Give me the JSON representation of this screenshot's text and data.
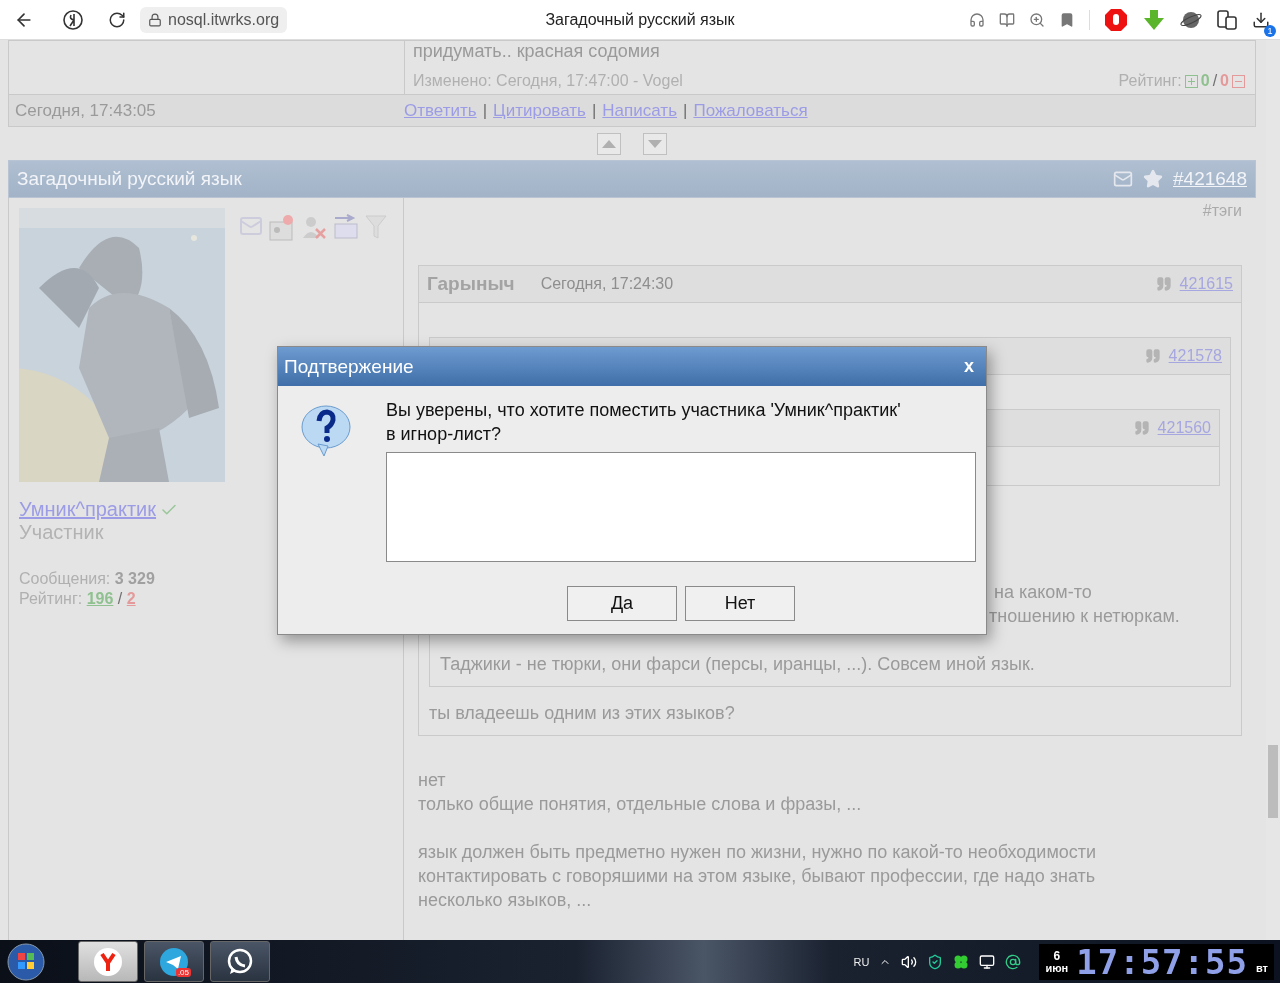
{
  "browser": {
    "url": "nosql.itwrks.org",
    "title": "Загадочный русский язык",
    "downloads_badge": "1"
  },
  "prev_post": {
    "text": "придумать.. красная содомия",
    "edited": "Изменено: Сегодня, 17:47:00 - Vogel",
    "rating_label": "Рейтинг:",
    "rating_plus": "0",
    "rating_sep": "/",
    "rating_minus": "0",
    "date": "Сегодня, 17:43:05",
    "actions": [
      "Ответить",
      "Цитировать",
      "Написать",
      "Пожаловаться"
    ],
    "action_sep": "|"
  },
  "post": {
    "title": "Загадочный русский язык",
    "number": "#421648",
    "author": {
      "name": "Умник^практик",
      "verified": true,
      "role": "Участник",
      "messages_label": "Сообщения:",
      "messages": "3 329",
      "rating_label": "Рейтинг:",
      "rating_plus": "196",
      "rating_sep": "/",
      "rating_minus": "2"
    },
    "tags": "#тэги",
    "quote": {
      "author": "Гарыныч",
      "date": "Сегодня, 17:24:30",
      "ref": "421615",
      "quote": {
        "ref": "421578",
        "quote": {
          "ref": "421560"
        },
        "fragments": [
          "на каком-то",
          "тношению к нетюркам."
        ],
        "text": "Таджики - не тюрки, они фарси (персы, иранцы, ...). Совсем иной язык."
      },
      "text": "ты владеешь одним из этих языков?"
    },
    "reply": [
      [
        "нет",
        "только общие понятия, отдельные слова и фразы, ..."
      ],
      [
        "язык должен быть предметно нужен по жизни, нужно по какой-то необходимости",
        "контактировать с говоряшими на этом языке, бывают профессии, где надо знать",
        "несколько языков, ..."
      ]
    ]
  },
  "dialog": {
    "title": "Подтвержение",
    "close": "x",
    "message_lines": [
      "Вы уверены, что хотите поместить участника 'Умник^практик'",
      "в игнор-лист?"
    ],
    "buttons": [
      "Да",
      "Нет"
    ]
  },
  "taskbar": {
    "apps": [
      {
        "kind": "yandex",
        "selected": true
      },
      {
        "kind": "telegram",
        "selected": false,
        "badge": ".05"
      },
      {
        "kind": "whatsapp",
        "selected": false
      }
    ],
    "lang": "RU",
    "clock": {
      "day": "6",
      "month": "июн",
      "time": "17:57:55",
      "weekday": "вт"
    }
  }
}
